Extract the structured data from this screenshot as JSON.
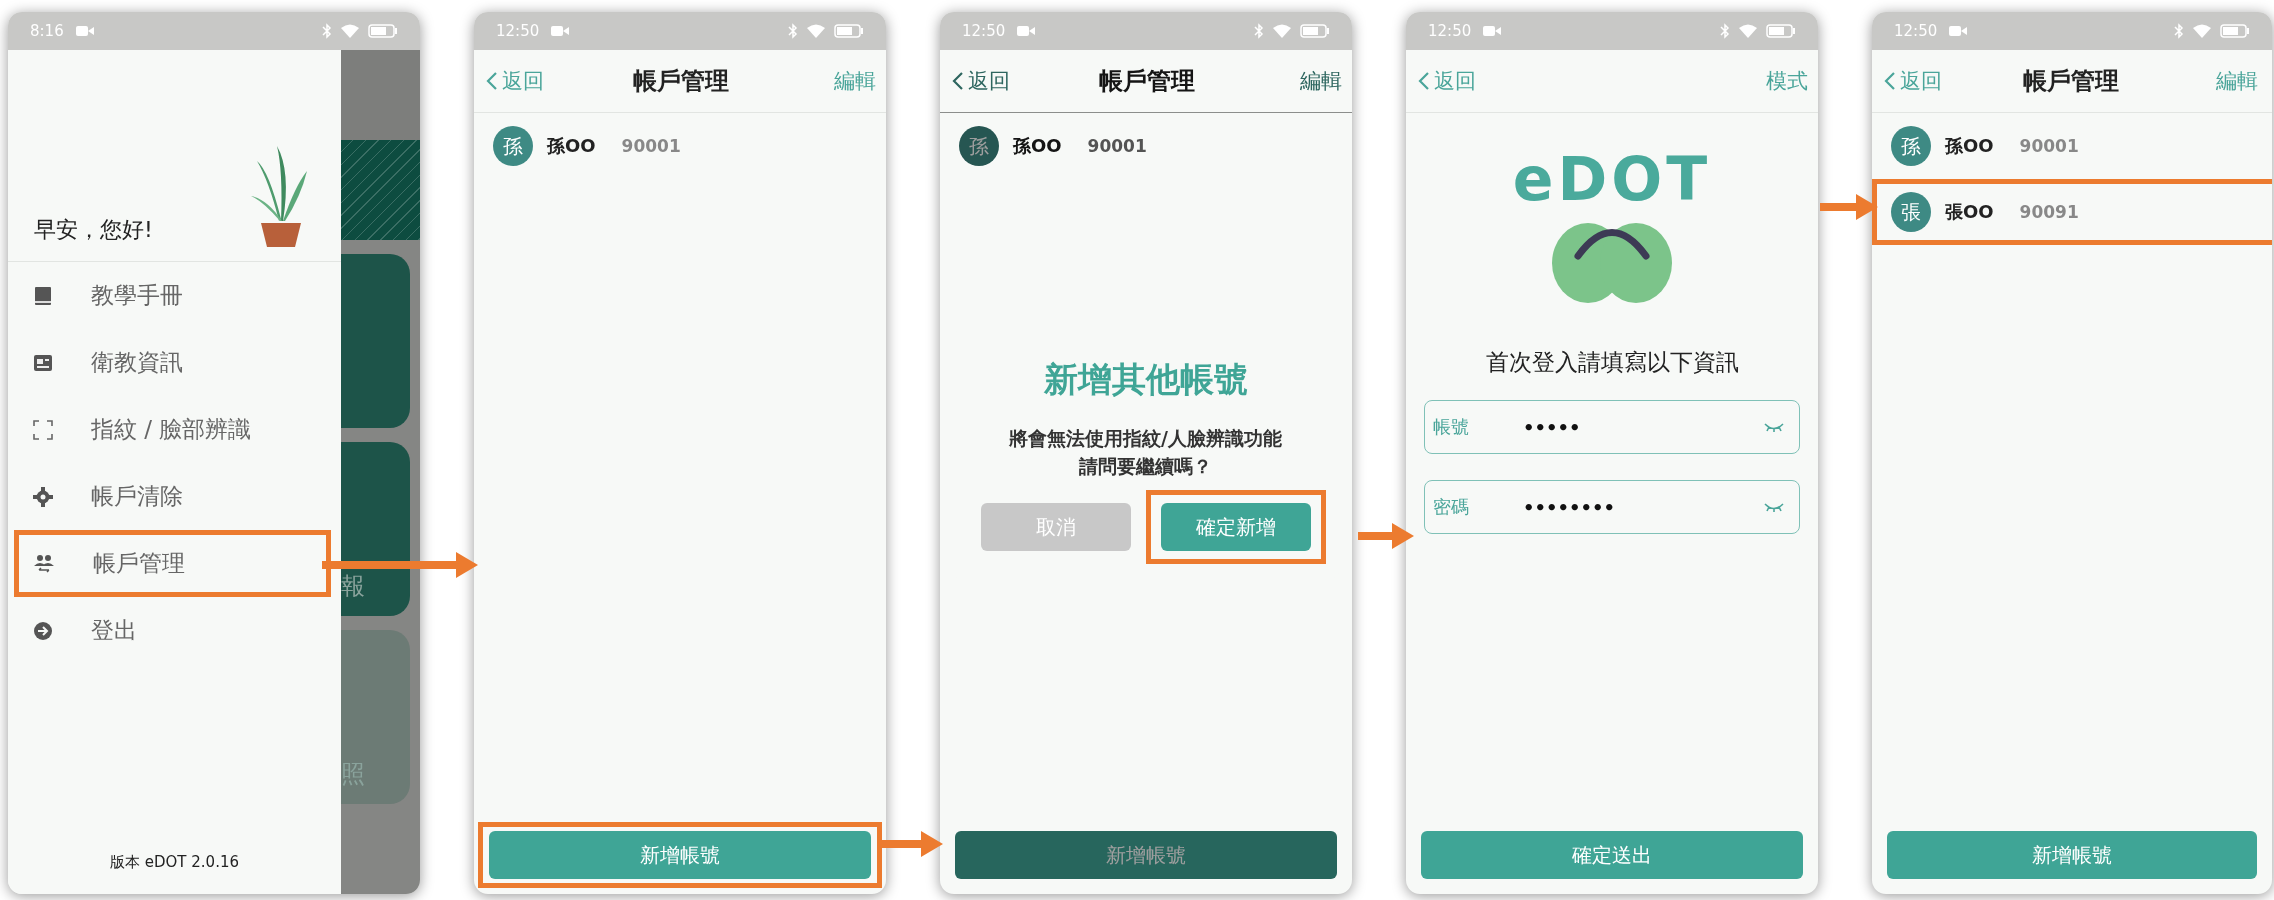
{
  "screens": [
    {
      "kind": "drawer",
      "time": "8:16",
      "greeting": "早安，您好!",
      "menu": [
        {
          "label": "教學手冊",
          "highlighted": false
        },
        {
          "label": "衛教資訊",
          "highlighted": false
        },
        {
          "label": "指紋 / 臉部辨識",
          "highlighted": false
        },
        {
          "label": "帳戶清除",
          "highlighted": false
        },
        {
          "label": "帳戶管理",
          "highlighted": true
        },
        {
          "label": "登出",
          "highlighted": false
        }
      ],
      "version": "版本 eDOT 2.0.16",
      "background_labels": [
        "報",
        "照"
      ]
    },
    {
      "kind": "accounts",
      "time": "12:50",
      "back": "返回",
      "title": "帳戶管理",
      "action": "編輯",
      "dimmed": false,
      "accounts": [
        {
          "avatar": "孫",
          "name": "孫OO",
          "number": "90001",
          "highlighted": false
        }
      ],
      "button": {
        "label": "新增帳號",
        "highlighted": true
      }
    },
    {
      "kind": "accounts",
      "time": "12:50",
      "back": "返回",
      "title": "帳戶管理",
      "action": "編輯",
      "dimmed": true,
      "accounts": [
        {
          "avatar": "孫",
          "name": "孫OO",
          "number": "90001",
          "highlighted": false
        }
      ],
      "button": {
        "label": "新增帳號",
        "highlighted": false
      },
      "dialog": {
        "title": "新增其他帳號",
        "message": [
          "將會無法使用指紋/人臉辨識功能",
          "請問要繼續嗎？"
        ],
        "buttons": [
          {
            "label": "取消",
            "disabled": true,
            "highlighted": false
          },
          {
            "label": "確定新增",
            "disabled": false,
            "highlighted": true
          }
        ]
      }
    },
    {
      "kind": "login",
      "time": "12:50",
      "back": "返回",
      "action": "模式",
      "logo": "eDOT",
      "prompt": "首次登入請填寫以下資訊",
      "fields": [
        {
          "label": "帳號",
          "value": "•••••"
        },
        {
          "label": "密碼",
          "value": "••••••••"
        }
      ],
      "button": {
        "label": "確定送出",
        "highlighted": false
      }
    },
    {
      "kind": "accounts",
      "time": "12:50",
      "back": "返回",
      "title": "帳戶管理",
      "action": "編輯",
      "dimmed": false,
      "accounts": [
        {
          "avatar": "孫",
          "name": "孫OO",
          "number": "90001",
          "highlighted": false
        },
        {
          "avatar": "張",
          "name": "張OO",
          "number": "90091",
          "highlighted": true
        }
      ],
      "button": {
        "label": "新增帳號",
        "highlighted": false
      }
    }
  ]
}
